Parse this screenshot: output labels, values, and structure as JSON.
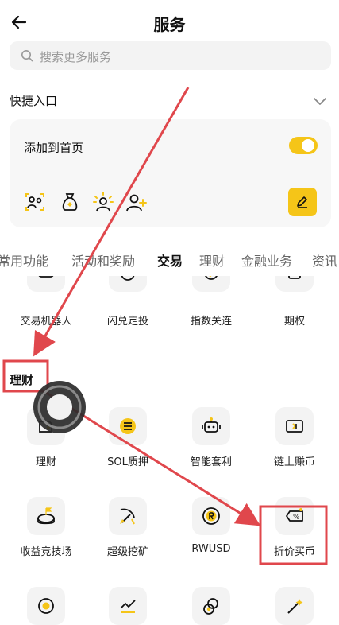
{
  "header": {
    "title": "服务"
  },
  "search": {
    "placeholder": "搜索更多服务"
  },
  "quick_entry": {
    "title": "快捷入口",
    "add_to_home_label": "添加到首页",
    "toggle_on": true
  },
  "tabs": [
    "常用功能",
    "活动和奖励",
    "交易",
    "理财",
    "金融业务",
    "资讯"
  ],
  "trade_items": [
    "交易机器人",
    "闪兑定投",
    "指数关连",
    "期权"
  ],
  "finance": {
    "section_title": "理财",
    "items": [
      "理财",
      "SOL质押",
      "智能套利",
      "链上赚币",
      "收益竞技场",
      "超级挖矿",
      "RWUSD",
      "折价买币"
    ]
  },
  "colors": {
    "accent": "#F5C518",
    "annotation": "#E0474C"
  }
}
